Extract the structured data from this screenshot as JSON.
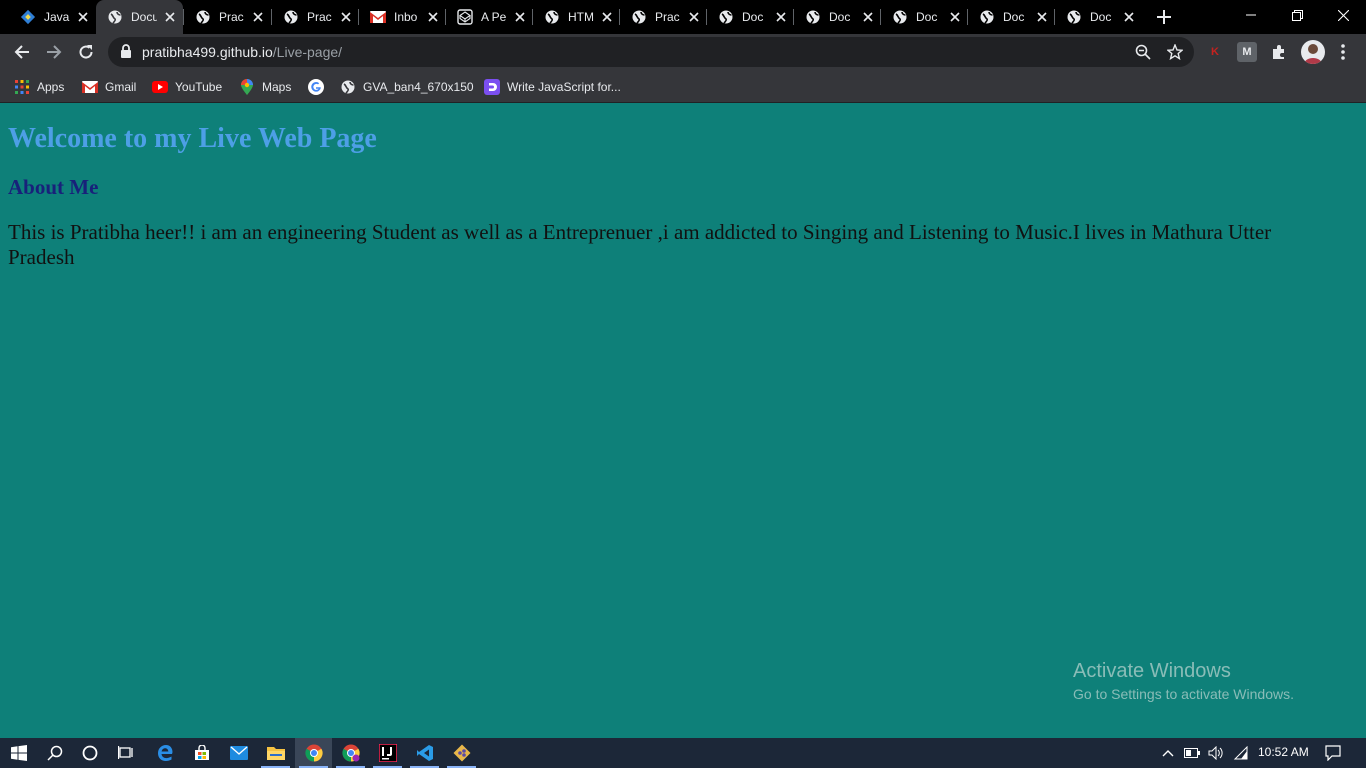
{
  "browser": {
    "tabs": [
      {
        "title": "Java",
        "icon": "javascript-diamond-icon",
        "active": false
      },
      {
        "title": "Docu",
        "icon": "globe-icon",
        "active": true
      },
      {
        "title": "Prac",
        "icon": "globe-icon",
        "active": false
      },
      {
        "title": "Prac",
        "icon": "globe-icon",
        "active": false
      },
      {
        "title": "Inbo",
        "icon": "gmail-icon",
        "active": false
      },
      {
        "title": "A Pe",
        "icon": "codepen-icon",
        "active": false
      },
      {
        "title": "HTM",
        "icon": "globe-icon",
        "active": false
      },
      {
        "title": "Prac",
        "icon": "globe-icon",
        "active": false
      },
      {
        "title": "Doc",
        "icon": "globe-icon",
        "active": false
      },
      {
        "title": "Doc",
        "icon": "globe-icon",
        "active": false
      },
      {
        "title": "Doc",
        "icon": "globe-icon",
        "active": false
      },
      {
        "title": "Doc",
        "icon": "globe-icon",
        "active": false
      },
      {
        "title": "Doc",
        "icon": "globe-icon",
        "active": false
      }
    ],
    "address": {
      "host": "pratibha499.github.io",
      "path": "/Live-page/"
    },
    "extensions": {
      "k_label": "K",
      "m_label": "M"
    },
    "bookmarks": [
      {
        "label": "Apps",
        "icon": "apps-grid-icon"
      },
      {
        "label": "Gmail",
        "icon": "gmail-icon"
      },
      {
        "label": "YouTube",
        "icon": "youtube-icon"
      },
      {
        "label": "Maps",
        "icon": "maps-pin-icon"
      },
      {
        "label": "",
        "icon": "google-icon"
      },
      {
        "label": "GVA_ban4_670x150",
        "icon": "globe-icon"
      },
      {
        "label": "Write JavaScript for...",
        "icon": "javascript-bookmark-icon"
      }
    ]
  },
  "page": {
    "heading": "Welcome to my Live Web Page",
    "subheading": "About Me",
    "paragraph": "This is Pratibha heer!! i am an engineering Student as well as a Entreprenuer ,i am addicted to Singing and Listening to Music.I lives in Mathura Utter Pradesh"
  },
  "watermark": {
    "line1": "Activate Windows",
    "line2": "Go to Settings to activate Windows."
  },
  "taskbar": {
    "clock": "10:52 AM"
  },
  "colors": {
    "page_bg": "#0e8079",
    "heading": "#4d9fe6",
    "subheading": "#18217a"
  }
}
